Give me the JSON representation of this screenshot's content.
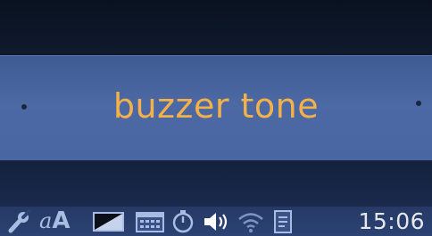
{
  "display": {
    "mode_title": "buzzer tone"
  },
  "status_bar": {
    "icons": [
      "wrench-icon",
      "font-size-icon",
      "brightness-icon",
      "calendar-icon",
      "timer-icon",
      "volume-icon",
      "wifi-icon",
      "document-icon"
    ],
    "font_icon_small": "a",
    "font_icon_large": "A",
    "time": "15:06"
  },
  "colors": {
    "title": "#f2b14a",
    "highlight_bar": "#4866a1",
    "status_bar": "#2b4272",
    "icon": "#a9bde2"
  }
}
